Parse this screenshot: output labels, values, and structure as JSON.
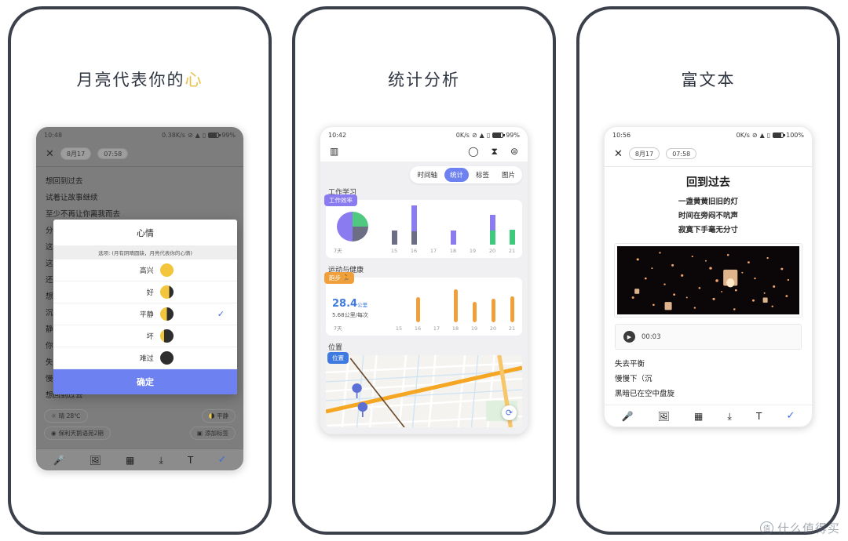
{
  "panels": [
    {
      "title_main": "月亮代表你的",
      "title_accent": "心"
    },
    {
      "title_main": "统计分析",
      "title_accent": ""
    },
    {
      "title_main": "富文本",
      "title_accent": ""
    }
  ],
  "phone1": {
    "status": {
      "time": "10:48",
      "net": "0.38K/s",
      "battery": "99%"
    },
    "close_label": "✕",
    "date_chip": "8月17",
    "time_chip": "07:58",
    "lines": [
      "想回到过去",
      "试着让故事继续",
      "至少不再让你离我而去",
      "分散",
      "这次",
      "这样",
      "还来",
      "想回",
      "沉默",
      "静静",
      "你的",
      "失去",
      "慢慢",
      "想回到过去"
    ],
    "tags": {
      "weather": "晴 28℃",
      "weather_icon": "sun-icon",
      "location": "保利天鹅语苑2期",
      "location_icon": "pin-icon",
      "mood": "平静",
      "add_tag": "添加标签",
      "add_tag_icon": "tag-icon"
    },
    "toolbar": [
      {
        "name": "mic-icon",
        "glyph": "🎤"
      },
      {
        "name": "image-icon",
        "glyph": "🖼"
      },
      {
        "name": "grid-icon",
        "glyph": "▦"
      },
      {
        "name": "download-icon",
        "glyph": "⤓"
      },
      {
        "name": "text-format-icon",
        "glyph": "T"
      },
      {
        "name": "confirm-check-icon",
        "glyph": "✓"
      }
    ],
    "modal": {
      "title": "心情",
      "subtitle": "选项: (月有阴晴圆缺，月亮代表你的心情)",
      "options": [
        {
          "label": "高兴",
          "moon": "moon-full",
          "selected": false
        },
        {
          "label": "好",
          "moon": "moon-gib",
          "selected": false
        },
        {
          "label": "平静",
          "moon": "moon-half",
          "selected": true
        },
        {
          "label": "坏",
          "moon": "moon-cres",
          "selected": false
        },
        {
          "label": "难过",
          "moon": "moon-new",
          "selected": false
        }
      ],
      "confirm": "确定"
    }
  },
  "phone2": {
    "status": {
      "time": "10:42",
      "net": "0K/s",
      "battery": "99%"
    },
    "header_icons": [
      {
        "name": "stats-icon",
        "glyph": "▥"
      },
      {
        "name": "search-icon",
        "glyph": "◯"
      },
      {
        "name": "filter-icon",
        "glyph": "⧗"
      },
      {
        "name": "profile-icon",
        "glyph": "⊜"
      }
    ],
    "tabs": [
      {
        "label": "时间轴",
        "active": false
      },
      {
        "label": "统计",
        "active": true
      },
      {
        "label": "标签",
        "active": false
      },
      {
        "label": "图片",
        "active": false
      }
    ],
    "sections": [
      {
        "label": "工作学习",
        "badge": "工作效率"
      },
      {
        "label": "运动与健康",
        "badge": "跑步"
      },
      {
        "label": "位置",
        "badge": "位置"
      }
    ],
    "work": {
      "range": "7天",
      "distance_stat": ""
    },
    "sport": {
      "total": "28.4",
      "total_unit": "公里",
      "average": "5.68公里/每次",
      "range": "7天"
    },
    "refresh_icon": "refresh-icon",
    "chart_data": [
      {
        "type": "pie",
        "title": "工作效率",
        "labels": [
          "绿色",
          "灰色",
          "紫色"
        ],
        "values": [
          25,
          25,
          50
        ],
        "colors": [
          "#4fc97f",
          "#6b6e85",
          "#8b7bf0"
        ]
      },
      {
        "type": "bar",
        "title": "工作效率",
        "categories": [
          "15",
          "16",
          "17",
          "18",
          "19",
          "20",
          "21"
        ],
        "series": [
          {
            "name": "紫色",
            "color": "#8b7bf0",
            "values": [
              0,
              33,
              0,
              18,
              0,
              20,
              0
            ]
          },
          {
            "name": "灰色",
            "color": "#6b6e85",
            "values": [
              18,
              17,
              0,
              0,
              0,
              0,
              0
            ]
          },
          {
            "name": "绿色",
            "color": "#3fc97c",
            "values": [
              0,
              0,
              0,
              0,
              0,
              18,
              19
            ]
          }
        ],
        "xlabel": "",
        "ylabel": "",
        "ylim": [
          0,
          52
        ],
        "stacked": true,
        "grid": false
      },
      {
        "type": "bar",
        "title": "跑步",
        "categories": [
          "15",
          "16",
          "17",
          "18",
          "19",
          "20",
          "21"
        ],
        "values": [
          0,
          32,
          0,
          43,
          26,
          30,
          33
        ],
        "colors": "#f0a03a",
        "xlabel": "",
        "ylabel": "",
        "ylim": [
          0,
          48
        ],
        "grid": false
      }
    ]
  },
  "phone3": {
    "status": {
      "time": "10:56",
      "net": "0K/s",
      "battery": "100%"
    },
    "close_label": "✕",
    "date_chip": "8月17",
    "time_chip": "07:58",
    "title": "回到过去",
    "center_lines": [
      "一盏黄黄旧旧的灯",
      "时间在旁闷不吭声",
      "寂寞下手毫无分寸"
    ],
    "photo_alt": "night-sky-lanterns",
    "audio": {
      "duration": "00:03",
      "play_icon": "play-icon"
    },
    "body_lines": [
      "失去平衡",
      "慢慢下（沉",
      "黑暗已在空中盘旋"
    ],
    "toolbar": [
      {
        "name": "mic-icon",
        "glyph": "🎤"
      },
      {
        "name": "image-icon",
        "glyph": "🖼"
      },
      {
        "name": "grid-icon",
        "glyph": "▦"
      },
      {
        "name": "download-icon",
        "glyph": "⤓"
      },
      {
        "name": "text-format-icon",
        "glyph": "T"
      },
      {
        "name": "confirm-check-icon",
        "glyph": "✓"
      }
    ]
  },
  "watermark": {
    "mark": "值",
    "text": "什么值得买"
  },
  "colors": {
    "frame": "#3b404b",
    "accent_yellow": "#e8c24a",
    "accent_blue": "#6d82f0",
    "purple": "#8b7bf0",
    "green": "#3fc97c",
    "orange": "#f0a03a",
    "gray_bar": "#6b6e85"
  }
}
